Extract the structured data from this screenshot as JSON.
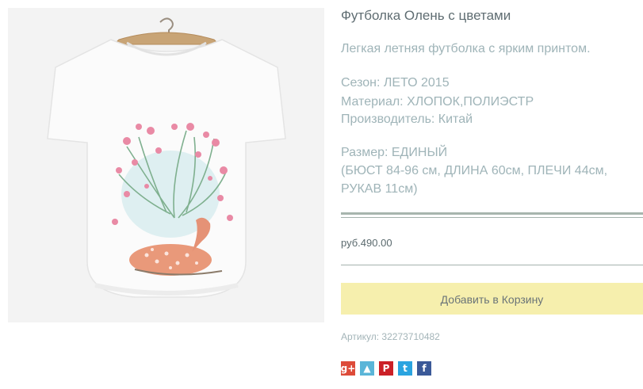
{
  "product": {
    "title": "Футболка Олень с цветами",
    "description": "Легкая летняя футболка с ярким принтом.",
    "season": "Сезон: ЛЕТО 2015",
    "material": "Материал: ХЛОПОК,ПОЛИЭСТР",
    "manufacturer": "Производитель: Китай",
    "size_line": "Размер: ЕДИНЫЙ",
    "measures_line1": "(БЮСТ 84-96 см, ДЛИНА 60см, ПЛЕЧИ 44см,",
    "measures_line2": "РУКАВ 11см)",
    "price": "руб.490.00",
    "add_to_cart_label": "Добавить в Корзину",
    "sku_label": "Артикул:",
    "sku_value": "32273710482"
  },
  "share": [
    {
      "name": "google-plus-icon",
      "glyph": "g+",
      "color": "#dd4b39"
    },
    {
      "name": "vk-bookmark-icon",
      "glyph": "▲",
      "color": "#5ab5d8"
    },
    {
      "name": "pinterest-icon",
      "glyph": "P",
      "color": "#cb2027"
    },
    {
      "name": "twitter-icon",
      "glyph": "t",
      "color": "#2aa4e0"
    },
    {
      "name": "facebook-icon",
      "glyph": "f",
      "color": "#3b5998"
    }
  ],
  "colors": {
    "accent_button": "#f6efad",
    "separator": "#a7b5ae",
    "text": "#9fb4b8"
  }
}
